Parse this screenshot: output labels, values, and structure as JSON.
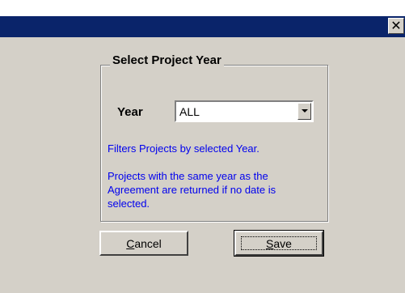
{
  "window": {
    "close_glyph": "✕"
  },
  "groupbox": {
    "title": "Select Project Year"
  },
  "year_field": {
    "label": "Year",
    "selected_value": "ALL"
  },
  "help": {
    "line1": "Filters Projects by selected Year.",
    "line2": "Projects with the same year as the",
    "line3": "Agreement are returned if no date is",
    "line4": "selected."
  },
  "buttons": {
    "cancel_first": "C",
    "cancel_rest": "ancel",
    "save_first": "S",
    "save_rest": "ave"
  },
  "colors": {
    "titlebar": "#0a246a",
    "dialog_bg": "#d4d0c8",
    "help_text": "#0000ee"
  }
}
